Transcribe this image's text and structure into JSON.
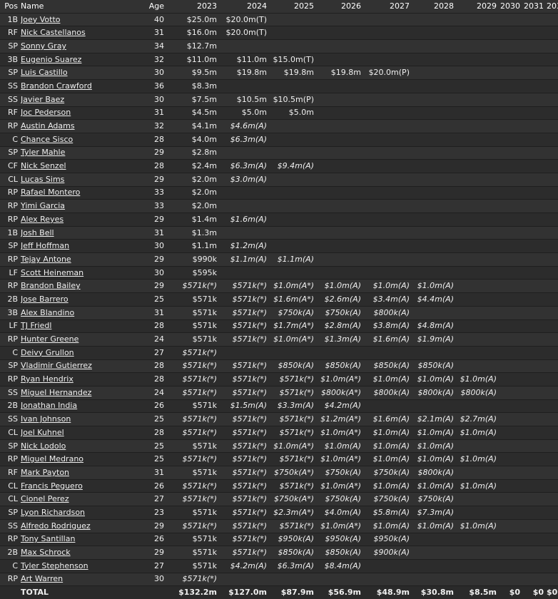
{
  "columns": [
    "Pos",
    "Name",
    "Age",
    "2023",
    "2024",
    "2025",
    "2026",
    "2027",
    "2028",
    "2029",
    "2030",
    "2031",
    "2032"
  ],
  "rows": [
    {
      "pos": "1B",
      "name": "Joey Votto",
      "age": "40",
      "cells": [
        "$25.0m",
        "$20.0m(T)",
        "",
        "",
        "",
        "",
        "",
        "",
        "",
        ""
      ]
    },
    {
      "pos": "RF",
      "name": "Nick Castellanos",
      "age": "31",
      "cells": [
        "$16.0m",
        "$20.0m(T)",
        "",
        "",
        "",
        "",
        "",
        "",
        "",
        ""
      ]
    },
    {
      "pos": "SP",
      "name": "Sonny Gray",
      "age": "34",
      "cells": [
        "$12.7m",
        "",
        "",
        "",
        "",
        "",
        "",
        "",
        "",
        ""
      ]
    },
    {
      "pos": "3B",
      "name": "Eugenio Suarez",
      "age": "32",
      "cells": [
        "$11.0m",
        "$11.0m",
        "$15.0m(T)",
        "",
        "",
        "",
        "",
        "",
        "",
        ""
      ]
    },
    {
      "pos": "SP",
      "name": "Luis Castillo",
      "age": "30",
      "cells": [
        "$9.5m",
        "$19.8m",
        "$19.8m",
        "$19.8m",
        "$20.0m(P)",
        "",
        "",
        "",
        "",
        ""
      ]
    },
    {
      "pos": "SS",
      "name": "Brandon Crawford",
      "age": "36",
      "cells": [
        "$8.3m",
        "",
        "",
        "",
        "",
        "",
        "",
        "",
        "",
        ""
      ]
    },
    {
      "pos": "SS",
      "name": "Javier Baez",
      "age": "30",
      "cells": [
        "$7.5m",
        "$10.5m",
        "$10.5m(P)",
        "",
        "",
        "",
        "",
        "",
        "",
        ""
      ]
    },
    {
      "pos": "RF",
      "name": "Joc Pederson",
      "age": "31",
      "cells": [
        "$4.5m",
        "$5.0m",
        "$5.0m",
        "",
        "",
        "",
        "",
        "",
        "",
        ""
      ]
    },
    {
      "pos": "RP",
      "name": "Austin Adams",
      "age": "32",
      "cells": [
        "$4.1m",
        "$4.6m(A)",
        "",
        "",
        "",
        "",
        "",
        "",
        "",
        ""
      ]
    },
    {
      "pos": "C",
      "name": "Chance Sisco",
      "age": "28",
      "cells": [
        "$4.0m",
        "$6.3m(A)",
        "",
        "",
        "",
        "",
        "",
        "",
        "",
        ""
      ]
    },
    {
      "pos": "SP",
      "name": "Tyler Mahle",
      "age": "29",
      "cells": [
        "$2.8m",
        "",
        "",
        "",
        "",
        "",
        "",
        "",
        "",
        ""
      ]
    },
    {
      "pos": "CF",
      "name": "Nick Senzel",
      "age": "28",
      "cells": [
        "$2.4m",
        "$6.3m(A)",
        "$9.4m(A)",
        "",
        "",
        "",
        "",
        "",
        "",
        ""
      ]
    },
    {
      "pos": "CL",
      "name": "Lucas Sims",
      "age": "29",
      "cells": [
        "$2.0m",
        "$3.0m(A)",
        "",
        "",
        "",
        "",
        "",
        "",
        "",
        ""
      ]
    },
    {
      "pos": "RP",
      "name": "Rafael Montero",
      "age": "33",
      "cells": [
        "$2.0m",
        "",
        "",
        "",
        "",
        "",
        "",
        "",
        "",
        ""
      ]
    },
    {
      "pos": "RP",
      "name": "Yimi Garcia",
      "age": "33",
      "cells": [
        "$2.0m",
        "",
        "",
        "",
        "",
        "",
        "",
        "",
        "",
        ""
      ]
    },
    {
      "pos": "RP",
      "name": "Alex Reyes",
      "age": "29",
      "cells": [
        "$1.4m",
        "$1.6m(A)",
        "",
        "",
        "",
        "",
        "",
        "",
        "",
        ""
      ]
    },
    {
      "pos": "1B",
      "name": "Josh Bell",
      "age": "31",
      "cells": [
        "$1.3m",
        "",
        "",
        "",
        "",
        "",
        "",
        "",
        "",
        ""
      ]
    },
    {
      "pos": "SP",
      "name": "Jeff Hoffman",
      "age": "30",
      "cells": [
        "$1.1m",
        "$1.2m(A)",
        "",
        "",
        "",
        "",
        "",
        "",
        "",
        ""
      ]
    },
    {
      "pos": "RP",
      "name": "Tejay Antone",
      "age": "29",
      "cells": [
        "$990k",
        "$1.1m(A)",
        "$1.1m(A)",
        "",
        "",
        "",
        "",
        "",
        "",
        ""
      ]
    },
    {
      "pos": "LF",
      "name": "Scott Heineman",
      "age": "30",
      "cells": [
        "$595k",
        "",
        "",
        "",
        "",
        "",
        "",
        "",
        "",
        ""
      ]
    },
    {
      "pos": "RP",
      "name": "Brandon Bailey",
      "age": "29",
      "cells": [
        "$571k(*)",
        "$571k(*)",
        "$1.0m(A*)",
        "$1.0m(A)",
        "$1.0m(A)",
        "$1.0m(A)",
        "",
        "",
        "",
        ""
      ]
    },
    {
      "pos": "2B",
      "name": "Jose Barrero",
      "age": "25",
      "cells": [
        "$571k",
        "$571k(*)",
        "$1.6m(A*)",
        "$2.6m(A)",
        "$3.4m(A)",
        "$4.4m(A)",
        "",
        "",
        "",
        ""
      ]
    },
    {
      "pos": "3B",
      "name": "Alex Blandino",
      "age": "31",
      "cells": [
        "$571k",
        "$571k(*)",
        "$750k(A)",
        "$750k(A)",
        "$800k(A)",
        "",
        "",
        "",
        "",
        ""
      ]
    },
    {
      "pos": "LF",
      "name": "TJ Friedl",
      "age": "28",
      "cells": [
        "$571k",
        "$571k(*)",
        "$1.7m(A*)",
        "$2.8m(A)",
        "$3.8m(A)",
        "$4.8m(A)",
        "",
        "",
        "",
        ""
      ]
    },
    {
      "pos": "RP",
      "name": "Hunter Greene",
      "age": "24",
      "cells": [
        "$571k",
        "$571k(*)",
        "$1.0m(A*)",
        "$1.3m(A)",
        "$1.6m(A)",
        "$1.9m(A)",
        "",
        "",
        "",
        ""
      ]
    },
    {
      "pos": "C",
      "name": "Deivy Grullon",
      "age": "27",
      "cells": [
        "$571k(*)",
        "",
        "",
        "",
        "",
        "",
        "",
        "",
        "",
        ""
      ]
    },
    {
      "pos": "SP",
      "name": "Vladimir Gutierrez",
      "age": "28",
      "cells": [
        "$571k(*)",
        "$571k(*)",
        "$850k(A)",
        "$850k(A)",
        "$850k(A)",
        "$850k(A)",
        "",
        "",
        "",
        ""
      ]
    },
    {
      "pos": "RP",
      "name": "Ryan Hendrix",
      "age": "28",
      "cells": [
        "$571k(*)",
        "$571k(*)",
        "$571k(*)",
        "$1.0m(A*)",
        "$1.0m(A)",
        "$1.0m(A)",
        "$1.0m(A)",
        "",
        "",
        ""
      ]
    },
    {
      "pos": "SS",
      "name": "Miguel Hernandez",
      "age": "24",
      "cells": [
        "$571k(*)",
        "$571k(*)",
        "$571k(*)",
        "$800k(A*)",
        "$800k(A)",
        "$800k(A)",
        "$800k(A)",
        "",
        "",
        ""
      ]
    },
    {
      "pos": "2B",
      "name": "Jonathan India",
      "age": "26",
      "cells": [
        "$571k",
        "$1.5m(A)",
        "$3.3m(A)",
        "$4.2m(A)",
        "",
        "",
        "",
        "",
        "",
        ""
      ]
    },
    {
      "pos": "SS",
      "name": "Ivan Johnson",
      "age": "25",
      "cells": [
        "$571k(*)",
        "$571k(*)",
        "$571k(*)",
        "$1.2m(A*)",
        "$1.6m(A)",
        "$2.1m(A)",
        "$2.7m(A)",
        "",
        "",
        ""
      ]
    },
    {
      "pos": "CL",
      "name": "Joel Kuhnel",
      "age": "28",
      "cells": [
        "$571k(*)",
        "$571k(*)",
        "$571k(*)",
        "$1.0m(A*)",
        "$1.0m(A)",
        "$1.0m(A)",
        "$1.0m(A)",
        "",
        "",
        ""
      ]
    },
    {
      "pos": "SP",
      "name": "Nick Lodolo",
      "age": "25",
      "cells": [
        "$571k",
        "$571k(*)",
        "$1.0m(A*)",
        "$1.0m(A)",
        "$1.0m(A)",
        "$1.0m(A)",
        "",
        "",
        "",
        ""
      ]
    },
    {
      "pos": "RP",
      "name": "Miguel Medrano",
      "age": "25",
      "cells": [
        "$571k(*)",
        "$571k(*)",
        "$571k(*)",
        "$1.0m(A*)",
        "$1.0m(A)",
        "$1.0m(A)",
        "$1.0m(A)",
        "",
        "",
        ""
      ]
    },
    {
      "pos": "RF",
      "name": "Mark Payton",
      "age": "31",
      "cells": [
        "$571k",
        "$571k(*)",
        "$750k(A*)",
        "$750k(A)",
        "$750k(A)",
        "$800k(A)",
        "",
        "",
        "",
        ""
      ]
    },
    {
      "pos": "CL",
      "name": "Francis Peguero",
      "age": "26",
      "cells": [
        "$571k(*)",
        "$571k(*)",
        "$571k(*)",
        "$1.0m(A*)",
        "$1.0m(A)",
        "$1.0m(A)",
        "$1.0m(A)",
        "",
        "",
        ""
      ]
    },
    {
      "pos": "CL",
      "name": "Cionel Perez",
      "age": "27",
      "cells": [
        "$571k(*)",
        "$571k(*)",
        "$750k(A*)",
        "$750k(A)",
        "$750k(A)",
        "$750k(A)",
        "",
        "",
        "",
        ""
      ]
    },
    {
      "pos": "SP",
      "name": "Lyon Richardson",
      "age": "23",
      "cells": [
        "$571k",
        "$571k(*)",
        "$2.3m(A*)",
        "$4.0m(A)",
        "$5.8m(A)",
        "$7.3m(A)",
        "",
        "",
        "",
        ""
      ]
    },
    {
      "pos": "SS",
      "name": "Alfredo Rodriguez",
      "age": "29",
      "cells": [
        "$571k(*)",
        "$571k(*)",
        "$571k(*)",
        "$1.0m(A*)",
        "$1.0m(A)",
        "$1.0m(A)",
        "$1.0m(A)",
        "",
        "",
        ""
      ]
    },
    {
      "pos": "RP",
      "name": "Tony Santillan",
      "age": "26",
      "cells": [
        "$571k",
        "$571k(*)",
        "$950k(A)",
        "$950k(A)",
        "$950k(A)",
        "",
        "",
        "",
        "",
        ""
      ]
    },
    {
      "pos": "2B",
      "name": "Max Schrock",
      "age": "29",
      "cells": [
        "$571k",
        "$571k(*)",
        "$850k(A)",
        "$850k(A)",
        "$900k(A)",
        "",
        "",
        "",
        "",
        ""
      ]
    },
    {
      "pos": "C",
      "name": "Tyler Stephenson",
      "age": "27",
      "cells": [
        "$571k",
        "$4.2m(A)",
        "$6.3m(A)",
        "$8.4m(A)",
        "",
        "",
        "",
        "",
        "",
        ""
      ]
    },
    {
      "pos": "RP",
      "name": "Art Warren",
      "age": "30",
      "cells": [
        "$571k(*)",
        "",
        "",
        "",
        "",
        "",
        "",
        "",
        "",
        ""
      ]
    }
  ],
  "total": {
    "label": "TOTAL",
    "cells": [
      "$132.2m",
      "$127.0m",
      "$87.9m",
      "$56.9m",
      "$48.9m",
      "$30.8m",
      "$8.5m",
      "$0",
      "$0",
      "$0"
    ]
  }
}
